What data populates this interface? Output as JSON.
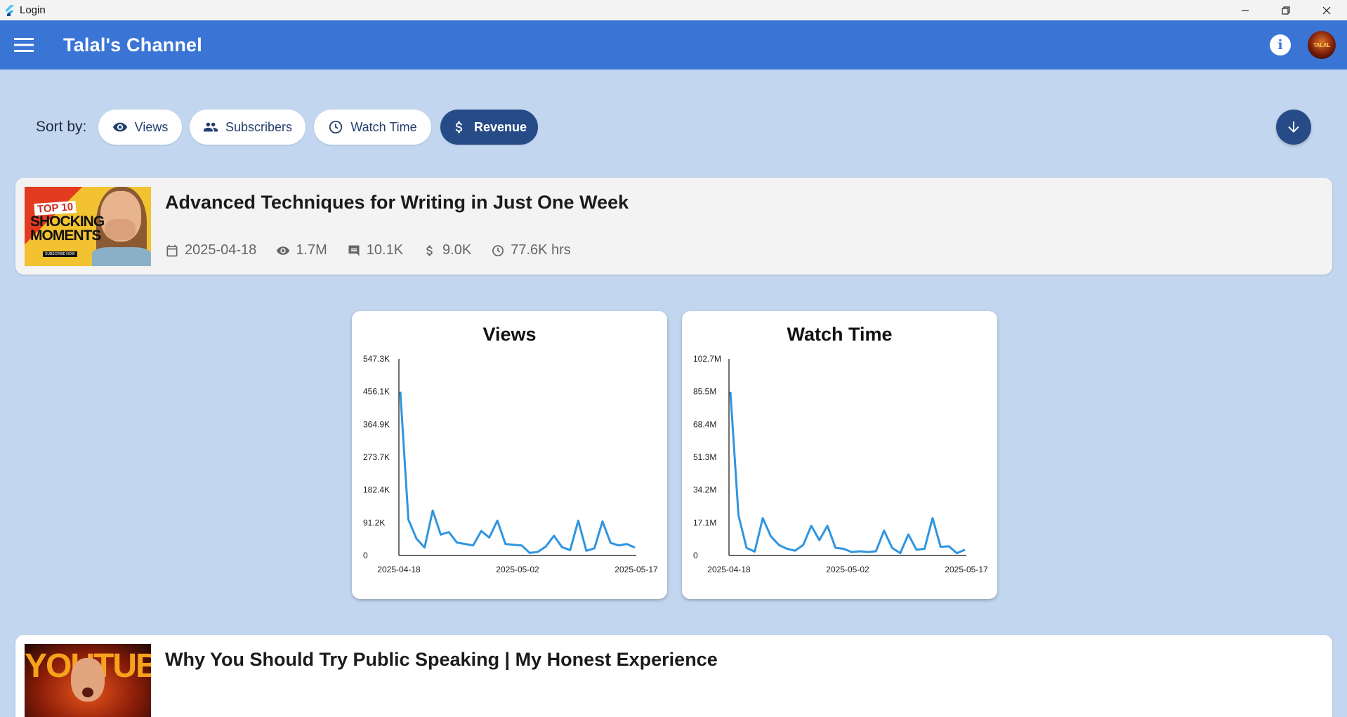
{
  "window": {
    "title": "Login"
  },
  "appbar": {
    "title": "Talal's Channel",
    "avatar_text": "TALAL"
  },
  "sort": {
    "label": "Sort by:",
    "options": [
      {
        "label": "Views",
        "icon": "eye-icon"
      },
      {
        "label": "Subscribers",
        "icon": "people-icon"
      },
      {
        "label": "Watch Time",
        "icon": "clock-icon"
      },
      {
        "label": "Revenue",
        "icon": "dollar-icon"
      }
    ],
    "selected": "Revenue",
    "order": "descending"
  },
  "videos": [
    {
      "title": "Advanced Techniques for Writing in Just One Week",
      "thumbnail_text": {
        "top": "TOP 10",
        "main": "SHOCKING MOMENTS",
        "sub": "SUBSCRIBE NOW"
      },
      "date": "2025-04-18",
      "views": "1.7M",
      "comments": "10.1K",
      "revenue": "9.0K",
      "watch_time": "77.6K hrs"
    },
    {
      "title": "Why You Should Try Public Speaking | My Honest Experience",
      "thumbnail_text": {
        "main": "YOUTUBE"
      }
    }
  ],
  "colors": {
    "appbar": "#3a75d6",
    "background": "#c3d6f0",
    "selected_chip": "#264b86",
    "line": "#2f95e0"
  },
  "chart_data": [
    {
      "type": "line",
      "title": "Views",
      "x_ticks": [
        "2025-04-18",
        "2025-05-02",
        "2025-05-17"
      ],
      "y_ticks": [
        "0",
        "91.2K",
        "182.4K",
        "273.7K",
        "364.9K",
        "456.1K",
        "547.3K"
      ],
      "ylim": [
        0,
        547300
      ],
      "x_start": "2025-04-18",
      "x_end": "2025-05-17",
      "series": [
        {
          "values": [
            456100,
            100000,
            47000,
            22000,
            125000,
            58000,
            65000,
            36000,
            32000,
            28000,
            68000,
            50000,
            97000,
            32000,
            30000,
            28000,
            7000,
            10000,
            25000,
            55000,
            23000,
            15000,
            97000,
            13000,
            20000,
            95000,
            35000,
            28000,
            32000,
            22000
          ]
        }
      ]
    },
    {
      "type": "line",
      "title": "Watch Time",
      "x_ticks": [
        "2025-04-18",
        "2025-05-02",
        "2025-05-17"
      ],
      "y_ticks": [
        "0",
        "17.1M",
        "34.2M",
        "51.3M",
        "68.4M",
        "85.5M",
        "102.7M"
      ],
      "ylim": [
        0,
        102700000
      ],
      "x_start": "2025-04-18",
      "x_end": "2025-05-17",
      "series": [
        {
          "values": [
            85500000,
            21000000,
            4000000,
            2000000,
            19500000,
            10000000,
            5500000,
            3500000,
            2500000,
            5500000,
            15500000,
            8000000,
            15500000,
            4000000,
            3500000,
            1800000,
            2200000,
            1800000,
            2200000,
            13000000,
            4000000,
            1200000,
            11000000,
            3000000,
            3500000,
            19500000,
            4500000,
            4800000,
            1200000,
            3000000
          ]
        }
      ]
    }
  ]
}
